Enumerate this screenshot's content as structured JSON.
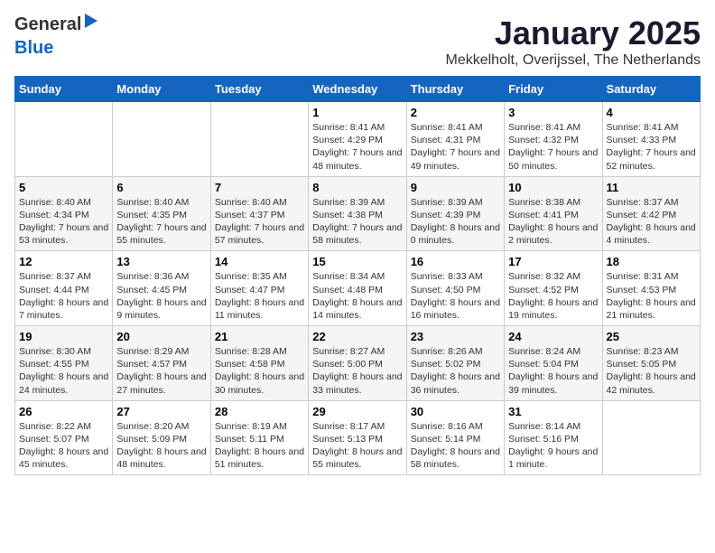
{
  "logo": {
    "text_general": "General",
    "text_blue": "Blue"
  },
  "title": "January 2025",
  "location": "Mekkelholt, Overijssel, The Netherlands",
  "days_of_week": [
    "Sunday",
    "Monday",
    "Tuesday",
    "Wednesday",
    "Thursday",
    "Friday",
    "Saturday"
  ],
  "weeks": [
    [
      {
        "day": "",
        "info": ""
      },
      {
        "day": "",
        "info": ""
      },
      {
        "day": "",
        "info": ""
      },
      {
        "day": "1",
        "info": "Sunrise: 8:41 AM\nSunset: 4:29 PM\nDaylight: 7 hours\nand 48 minutes."
      },
      {
        "day": "2",
        "info": "Sunrise: 8:41 AM\nSunset: 4:31 PM\nDaylight: 7 hours\nand 49 minutes."
      },
      {
        "day": "3",
        "info": "Sunrise: 8:41 AM\nSunset: 4:32 PM\nDaylight: 7 hours\nand 50 minutes."
      },
      {
        "day": "4",
        "info": "Sunrise: 8:41 AM\nSunset: 4:33 PM\nDaylight: 7 hours\nand 52 minutes."
      }
    ],
    [
      {
        "day": "5",
        "info": "Sunrise: 8:40 AM\nSunset: 4:34 PM\nDaylight: 7 hours\nand 53 minutes."
      },
      {
        "day": "6",
        "info": "Sunrise: 8:40 AM\nSunset: 4:35 PM\nDaylight: 7 hours\nand 55 minutes."
      },
      {
        "day": "7",
        "info": "Sunrise: 8:40 AM\nSunset: 4:37 PM\nDaylight: 7 hours\nand 57 minutes."
      },
      {
        "day": "8",
        "info": "Sunrise: 8:39 AM\nSunset: 4:38 PM\nDaylight: 7 hours\nand 58 minutes."
      },
      {
        "day": "9",
        "info": "Sunrise: 8:39 AM\nSunset: 4:39 PM\nDaylight: 8 hours\nand 0 minutes."
      },
      {
        "day": "10",
        "info": "Sunrise: 8:38 AM\nSunset: 4:41 PM\nDaylight: 8 hours\nand 2 minutes."
      },
      {
        "day": "11",
        "info": "Sunrise: 8:37 AM\nSunset: 4:42 PM\nDaylight: 8 hours\nand 4 minutes."
      }
    ],
    [
      {
        "day": "12",
        "info": "Sunrise: 8:37 AM\nSunset: 4:44 PM\nDaylight: 8 hours\nand 7 minutes."
      },
      {
        "day": "13",
        "info": "Sunrise: 8:36 AM\nSunset: 4:45 PM\nDaylight: 8 hours\nand 9 minutes."
      },
      {
        "day": "14",
        "info": "Sunrise: 8:35 AM\nSunset: 4:47 PM\nDaylight: 8 hours\nand 11 minutes."
      },
      {
        "day": "15",
        "info": "Sunrise: 8:34 AM\nSunset: 4:48 PM\nDaylight: 8 hours\nand 14 minutes."
      },
      {
        "day": "16",
        "info": "Sunrise: 8:33 AM\nSunset: 4:50 PM\nDaylight: 8 hours\nand 16 minutes."
      },
      {
        "day": "17",
        "info": "Sunrise: 8:32 AM\nSunset: 4:52 PM\nDaylight: 8 hours\nand 19 minutes."
      },
      {
        "day": "18",
        "info": "Sunrise: 8:31 AM\nSunset: 4:53 PM\nDaylight: 8 hours\nand 21 minutes."
      }
    ],
    [
      {
        "day": "19",
        "info": "Sunrise: 8:30 AM\nSunset: 4:55 PM\nDaylight: 8 hours\nand 24 minutes."
      },
      {
        "day": "20",
        "info": "Sunrise: 8:29 AM\nSunset: 4:57 PM\nDaylight: 8 hours\nand 27 minutes."
      },
      {
        "day": "21",
        "info": "Sunrise: 8:28 AM\nSunset: 4:58 PM\nDaylight: 8 hours\nand 30 minutes."
      },
      {
        "day": "22",
        "info": "Sunrise: 8:27 AM\nSunset: 5:00 PM\nDaylight: 8 hours\nand 33 minutes."
      },
      {
        "day": "23",
        "info": "Sunrise: 8:26 AM\nSunset: 5:02 PM\nDaylight: 8 hours\nand 36 minutes."
      },
      {
        "day": "24",
        "info": "Sunrise: 8:24 AM\nSunset: 5:04 PM\nDaylight: 8 hours\nand 39 minutes."
      },
      {
        "day": "25",
        "info": "Sunrise: 8:23 AM\nSunset: 5:05 PM\nDaylight: 8 hours\nand 42 minutes."
      }
    ],
    [
      {
        "day": "26",
        "info": "Sunrise: 8:22 AM\nSunset: 5:07 PM\nDaylight: 8 hours\nand 45 minutes."
      },
      {
        "day": "27",
        "info": "Sunrise: 8:20 AM\nSunset: 5:09 PM\nDaylight: 8 hours\nand 48 minutes."
      },
      {
        "day": "28",
        "info": "Sunrise: 8:19 AM\nSunset: 5:11 PM\nDaylight: 8 hours\nand 51 minutes."
      },
      {
        "day": "29",
        "info": "Sunrise: 8:17 AM\nSunset: 5:13 PM\nDaylight: 8 hours\nand 55 minutes."
      },
      {
        "day": "30",
        "info": "Sunrise: 8:16 AM\nSunset: 5:14 PM\nDaylight: 8 hours\nand 58 minutes."
      },
      {
        "day": "31",
        "info": "Sunrise: 8:14 AM\nSunset: 5:16 PM\nDaylight: 9 hours\nand 1 minute."
      },
      {
        "day": "",
        "info": ""
      }
    ]
  ]
}
